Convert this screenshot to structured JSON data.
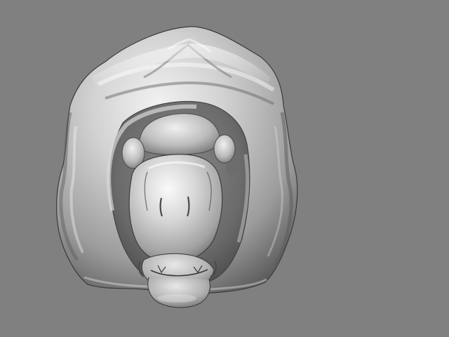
{
  "viewport": {
    "background_color": "#808080",
    "model_color": "#c4c4c4",
    "highlight_color": "#f2f2f2",
    "shadow_color": "#4e4e4e"
  },
  "model": {
    "object": "sculpted-creature-head",
    "view": "front-orthographic",
    "shading": "smooth-grey-matcap"
  }
}
